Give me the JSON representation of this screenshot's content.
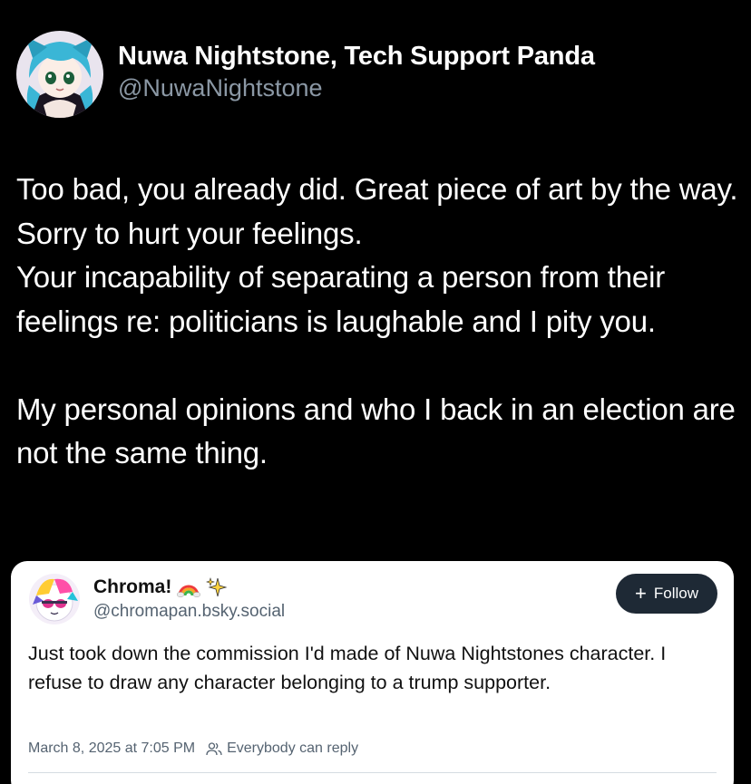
{
  "post": {
    "author_name": "Nuwa Nightstone, Tech Support Panda",
    "author_handle": "@NuwaNightstone",
    "body": [
      "Too bad, you already did. Great piece of art by the way. Sorry to hurt your feelings.",
      "Your incapability of separating a person from their feelings re: politicians is laughable and I pity you.",
      "",
      "My personal opinions and who I back in an election are not the same thing."
    ]
  },
  "embed": {
    "author_name": "Chroma!",
    "author_handle": "@chromapan.bsky.social",
    "follow_label": "Follow",
    "text": "Just took down the commission I'd made of Nuwa Nightstones character. I refuse to draw any character belonging to a trump supporter.",
    "timestamp": "March 8, 2025 at 7:05 PM",
    "reply_setting": "Everybody can reply"
  },
  "icons": {
    "name_emoji_1": "rainbow-icon",
    "name_emoji_2": "sparkles-icon",
    "reply_setting_icon": "people-icon"
  },
  "colors": {
    "background": "#000000",
    "handle_gray": "#8b98a5",
    "follow_button": "#1e2935",
    "card_background": "#ffffff"
  }
}
